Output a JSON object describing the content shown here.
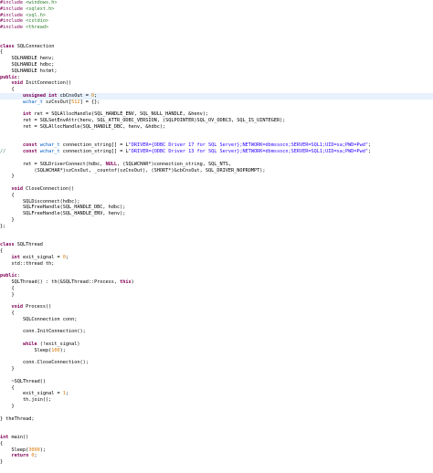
{
  "editor": {
    "lines": [
      {
        "y": 0,
        "tokens": [
          [
            "pp",
            "#include "
          ],
          [
            "inc",
            "<windows.h>"
          ]
        ]
      },
      {
        "y": 6.8,
        "tokens": [
          [
            "pp",
            "#include "
          ],
          [
            "inc",
            "<sqlext.h>"
          ]
        ]
      },
      {
        "y": 13.6,
        "tokens": [
          [
            "pp",
            "#include "
          ],
          [
            "inc",
            "<sql.h>"
          ]
        ]
      },
      {
        "y": 20.4,
        "tokens": [
          [
            "pp",
            "#include "
          ],
          [
            "inc",
            "<cstdio>"
          ]
        ]
      },
      {
        "y": 27.2,
        "tokens": [
          [
            "pp",
            "#include "
          ],
          [
            "inc",
            "<thread>"
          ]
        ]
      },
      {
        "y": 47.6,
        "tokens": [
          [
            "kw",
            "class"
          ],
          [
            "plain",
            " SQLConnection"
          ]
        ]
      },
      {
        "y": 54.4,
        "tokens": [
          [
            "plain",
            "{"
          ]
        ]
      },
      {
        "y": 61.2,
        "tokens": [
          [
            "plain",
            "    SQLHANDLE henv;"
          ]
        ]
      },
      {
        "y": 68.0,
        "tokens": [
          [
            "plain",
            "    SQLHANDLE hdbc;"
          ]
        ]
      },
      {
        "y": 74.8,
        "tokens": [
          [
            "plain",
            "    SQLHANDLE hstmt;"
          ]
        ]
      },
      {
        "y": 81.6,
        "tokens": [
          [
            "kw",
            "public"
          ],
          [
            "plain",
            ":"
          ]
        ]
      },
      {
        "y": 88.4,
        "tokens": [
          [
            "plain",
            "    "
          ],
          [
            "kw",
            "void"
          ],
          [
            "plain",
            " InitConnection()"
          ]
        ]
      },
      {
        "y": 95.2,
        "tokens": [
          [
            "plain",
            "    {"
          ]
        ]
      },
      {
        "y": 102.0,
        "hl": true,
        "tokens": [
          [
            "plain",
            "        "
          ],
          [
            "kw",
            "unsigned int"
          ],
          [
            "plain",
            " cbCnsOut = "
          ],
          [
            "num",
            "0"
          ],
          [
            "plain",
            ";"
          ]
        ]
      },
      {
        "y": 108.8,
        "tokens": [
          [
            "plain",
            "        "
          ],
          [
            "type",
            "wchar_t"
          ],
          [
            "plain",
            " szCnsOut["
          ],
          [
            "num",
            "512"
          ],
          [
            "plain",
            "] = {};"
          ]
        ]
      },
      {
        "y": 122.4,
        "tokens": [
          [
            "plain",
            "        "
          ],
          [
            "kw",
            "int"
          ],
          [
            "plain",
            " ret = SQLAllocHandle(SQL_HANDLE_ENV, SQL_NULL_HANDLE, &henv);"
          ]
        ]
      },
      {
        "y": 129.2,
        "tokens": [
          [
            "plain",
            "        ret = SQLSetEnvAttr(henv, SQL_ATTR_ODBC_VERSION, (SQLPOINTER)SQL_OV_ODBC3, SQL_IS_UINTEGER);"
          ]
        ]
      },
      {
        "y": 136.0,
        "tokens": [
          [
            "plain",
            "        ret = SQLAllocHandle(SQL_HANDLE_DBC, henv, &hdbc);"
          ]
        ]
      },
      {
        "y": 156.4,
        "tokens": [
          [
            "plain",
            "        "
          ],
          [
            "kw",
            "const"
          ],
          [
            "plain",
            " "
          ],
          [
            "type",
            "wchar_t"
          ],
          [
            "plain",
            " connection_string[] = L"
          ],
          [
            "str",
            "\"DRIVER={ODBC Driver 17 for SQL Server};NETWORK=dbmssocn;SERVER=SQL1;UID=sa;PWD=Pwd\""
          ],
          [
            "plain",
            ";"
          ]
        ]
      },
      {
        "y": 163.2,
        "tokens": [
          [
            "com",
            "//"
          ],
          [
            "plain",
            "      "
          ],
          [
            "kw",
            "const"
          ],
          [
            "plain",
            " "
          ],
          [
            "type",
            "wchar_t"
          ],
          [
            "plain",
            " connection_string[] = L"
          ],
          [
            "str",
            "\"DRIVER={ODBC Driver 13 for SQL Server};NETWORK=dbmssocn;SERVER=SQL1;UID=sa;PWD=Pwd\""
          ],
          [
            "plain",
            ";"
          ]
        ]
      },
      {
        "y": 176.8,
        "tokens": [
          [
            "plain",
            "        ret = SQLDriverConnect(hdbc, "
          ],
          [
            "kw",
            "NULL"
          ],
          [
            "plain",
            ", (SQLWCHAR*)connection_string, SQL_NTS,"
          ]
        ]
      },
      {
        "y": 183.6,
        "tokens": [
          [
            "plain",
            "            (SQLWCHAR*)szCnsOut, _countof(szCnsOut), (SHORT*)&cbCnsOut, SQL_DRIVER_NOPROMPT);"
          ]
        ]
      },
      {
        "y": 190.4,
        "tokens": [
          [
            "plain",
            "    }"
          ]
        ]
      },
      {
        "y": 204.0,
        "tokens": [
          [
            "plain",
            "    "
          ],
          [
            "kw",
            "void"
          ],
          [
            "plain",
            " CloseConnection()"
          ]
        ]
      },
      {
        "y": 210.8,
        "tokens": [
          [
            "plain",
            "    {"
          ]
        ]
      },
      {
        "y": 217.6,
        "tokens": [
          [
            "plain",
            "        SQLDisconnect(hdbc);"
          ]
        ]
      },
      {
        "y": 224.4,
        "tokens": [
          [
            "plain",
            "        SQLFreeHandle(SQL_HANDLE_DBC, hdbc);"
          ]
        ]
      },
      {
        "y": 231.2,
        "tokens": [
          [
            "plain",
            "        SQLFreeHandle(SQL_HANDLE_ENV, henv);"
          ]
        ]
      },
      {
        "y": 238.0,
        "tokens": [
          [
            "plain",
            "    }"
          ]
        ]
      },
      {
        "y": 244.8,
        "tokens": [
          [
            "plain",
            "};"
          ]
        ]
      },
      {
        "y": 265.2,
        "tokens": [
          [
            "kw",
            "class"
          ],
          [
            "plain",
            " SQLThread"
          ]
        ]
      },
      {
        "y": 272.0,
        "tokens": [
          [
            "plain",
            "{"
          ]
        ]
      },
      {
        "y": 278.8,
        "tokens": [
          [
            "plain",
            "    "
          ],
          [
            "kw",
            "int"
          ],
          [
            "plain",
            " exit_signal = "
          ],
          [
            "num",
            "0"
          ],
          [
            "plain",
            ";"
          ]
        ]
      },
      {
        "y": 285.6,
        "tokens": [
          [
            "plain",
            "    std::thread th;"
          ]
        ]
      },
      {
        "y": 299.2,
        "tokens": [
          [
            "kw",
            "public"
          ],
          [
            "plain",
            ":"
          ]
        ]
      },
      {
        "y": 306.0,
        "tokens": [
          [
            "plain",
            "    SQLThread() : th(&SQLThread::Process, "
          ],
          [
            "kw",
            "this"
          ],
          [
            "plain",
            ")"
          ]
        ]
      },
      {
        "y": 312.8,
        "tokens": [
          [
            "plain",
            "    {"
          ]
        ]
      },
      {
        "y": 319.6,
        "tokens": [
          [
            "plain",
            "    }"
          ]
        ]
      },
      {
        "y": 333.2,
        "tokens": [
          [
            "plain",
            "    "
          ],
          [
            "kw",
            "void"
          ],
          [
            "plain",
            " Process()"
          ]
        ]
      },
      {
        "y": 340.0,
        "tokens": [
          [
            "plain",
            "    {"
          ]
        ]
      },
      {
        "y": 346.8,
        "tokens": [
          [
            "plain",
            "        SQLConnection conn;"
          ]
        ]
      },
      {
        "y": 360.4,
        "tokens": [
          [
            "plain",
            "        conn.InitConnection();"
          ]
        ]
      },
      {
        "y": 374.0,
        "tokens": [
          [
            "plain",
            "        "
          ],
          [
            "kw",
            "while"
          ],
          [
            "plain",
            " (!exit_signal)"
          ]
        ]
      },
      {
        "y": 380.8,
        "tokens": [
          [
            "plain",
            "            Sleep("
          ],
          [
            "num",
            "100"
          ],
          [
            "plain",
            ");"
          ]
        ]
      },
      {
        "y": 394.4,
        "tokens": [
          [
            "plain",
            "        conn.CloseConnection();"
          ]
        ]
      },
      {
        "y": 401.2,
        "tokens": [
          [
            "plain",
            "    }"
          ]
        ]
      },
      {
        "y": 414.8,
        "tokens": [
          [
            "plain",
            "    ~SQLThread()"
          ]
        ]
      },
      {
        "y": 421.6,
        "tokens": [
          [
            "plain",
            "    {"
          ]
        ]
      },
      {
        "y": 428.4,
        "tokens": [
          [
            "plain",
            "        exit_signal = "
          ],
          [
            "num",
            "1"
          ],
          [
            "plain",
            ";"
          ]
        ]
      },
      {
        "y": 435.2,
        "tokens": [
          [
            "plain",
            "        th.join();"
          ]
        ]
      },
      {
        "y": 442.0,
        "tokens": [
          [
            "plain",
            "    }"
          ]
        ]
      },
      {
        "y": 455.6,
        "tokens": [
          [
            "plain",
            "} theThread;"
          ]
        ]
      },
      {
        "y": 476.0,
        "tokens": [
          [
            "kw",
            "int"
          ],
          [
            "plain",
            " main()"
          ]
        ]
      },
      {
        "y": 482.8,
        "tokens": [
          [
            "plain",
            "{"
          ]
        ]
      },
      {
        "y": 489.6,
        "tokens": [
          [
            "plain",
            "    Sleep("
          ],
          [
            "num",
            "3000"
          ],
          [
            "plain",
            ");"
          ]
        ]
      },
      {
        "y": 496.4,
        "tokens": [
          [
            "plain",
            "    "
          ],
          [
            "kw",
            "return"
          ],
          [
            "plain",
            " "
          ],
          [
            "num",
            "0"
          ],
          [
            "plain",
            ";"
          ]
        ]
      },
      {
        "y": 503.2,
        "tokens": [
          [
            "plain",
            "}"
          ]
        ]
      }
    ]
  }
}
